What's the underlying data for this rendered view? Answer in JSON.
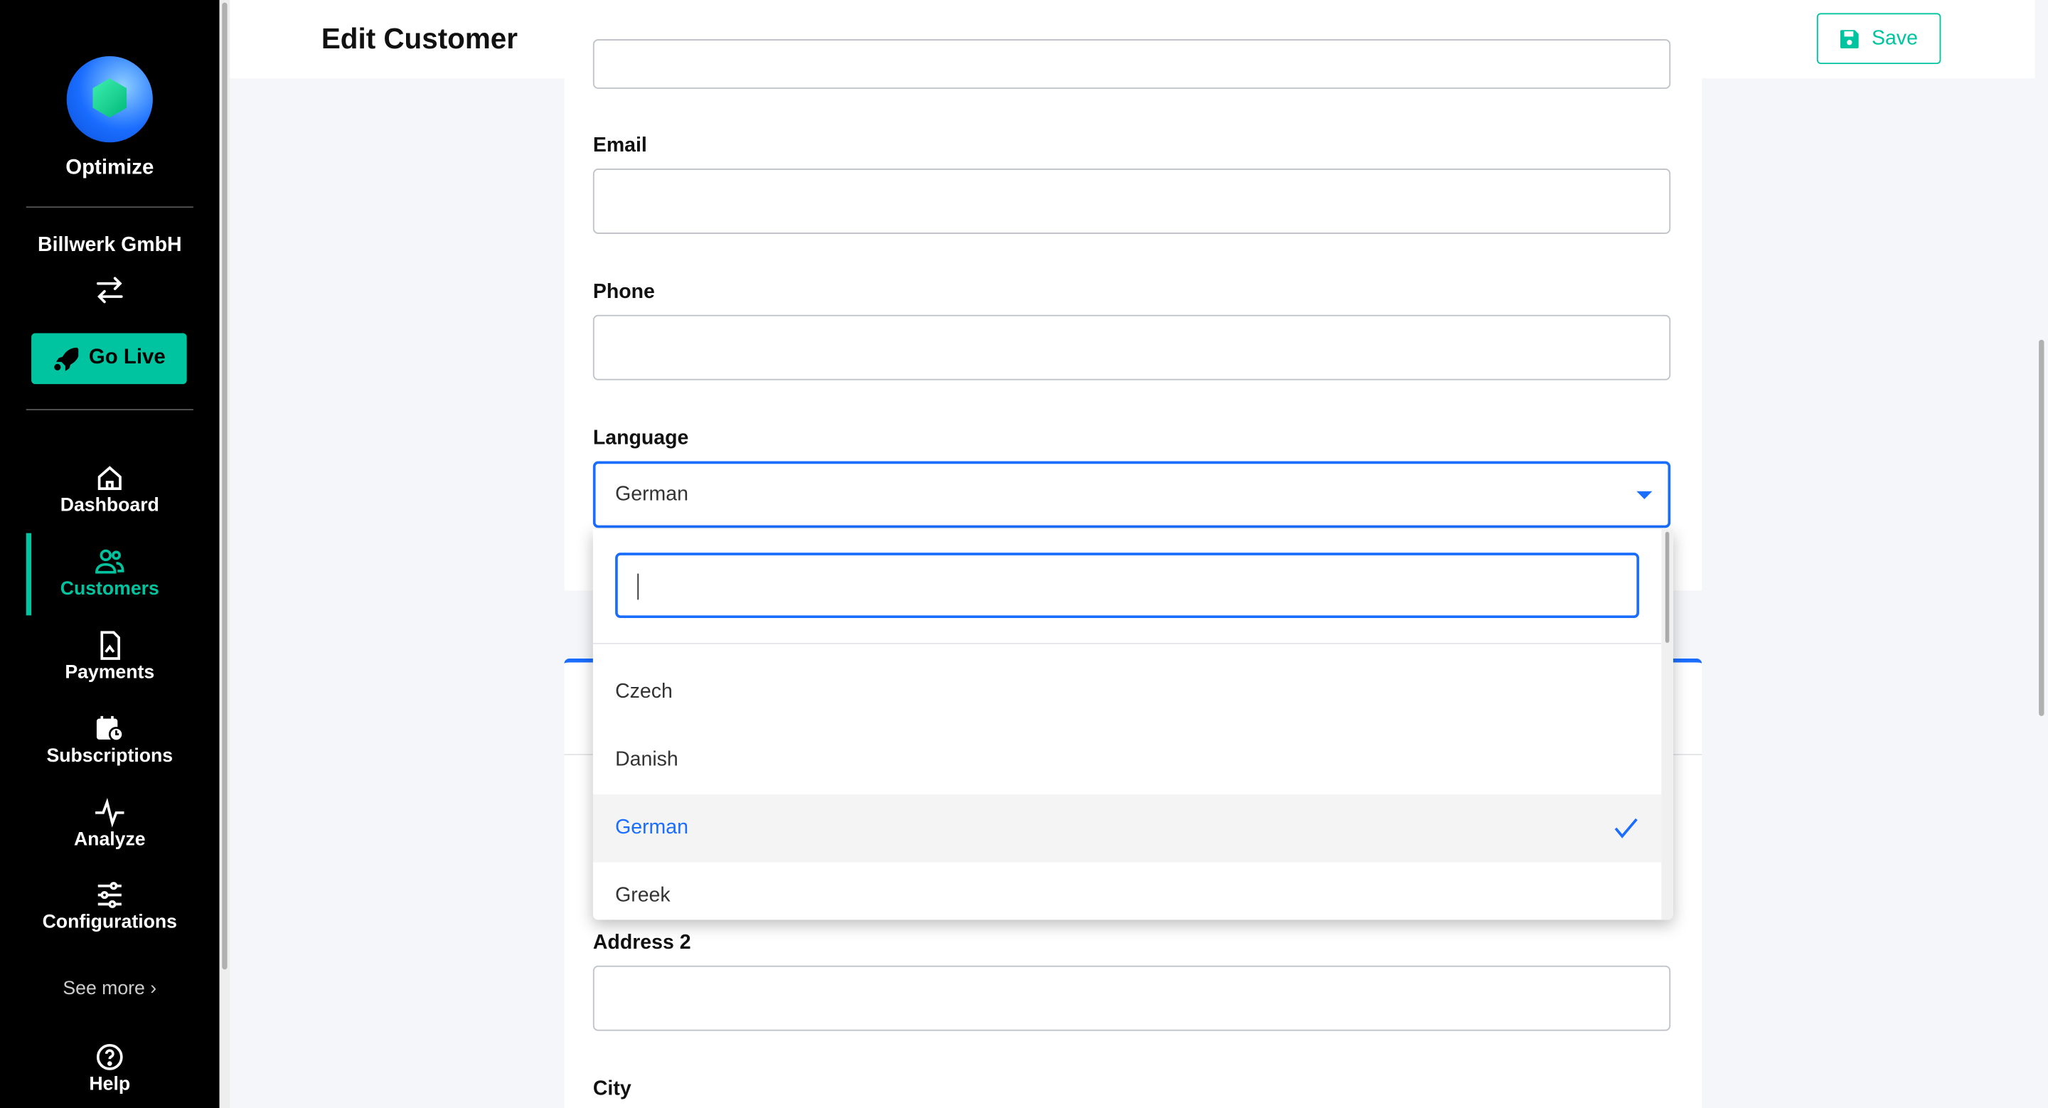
{
  "sidebar": {
    "app_name": "Optimize",
    "account": "Billwerk GmbH",
    "go_live": "Go Live",
    "nav": [
      {
        "label": "Dashboard",
        "icon": "home-icon"
      },
      {
        "label": "Customers",
        "icon": "users-icon",
        "active": true
      },
      {
        "label": "Payments",
        "icon": "document-icon"
      },
      {
        "label": "Subscriptions",
        "icon": "calendar-clock-icon"
      },
      {
        "label": "Analyze",
        "icon": "pulse-icon"
      },
      {
        "label": "Configurations",
        "icon": "sliders-icon"
      }
    ],
    "see_more": "See more",
    "help": "Help"
  },
  "header": {
    "title": "Edit Customer",
    "save": "Save"
  },
  "form": {
    "email_label": "Email",
    "email_value": "",
    "phone_label": "Phone",
    "phone_value": "",
    "language_label": "Language",
    "language_value": "German",
    "address2_label": "Address 2",
    "address2_value": "",
    "city_label": "City"
  },
  "dropdown": {
    "search_value": "",
    "options": [
      "Czech",
      "Danish",
      "German",
      "Greek"
    ],
    "selected": "German"
  },
  "colors": {
    "accent": "#00c4a0",
    "primary": "#1a6dff",
    "sidebar": "#000000"
  }
}
